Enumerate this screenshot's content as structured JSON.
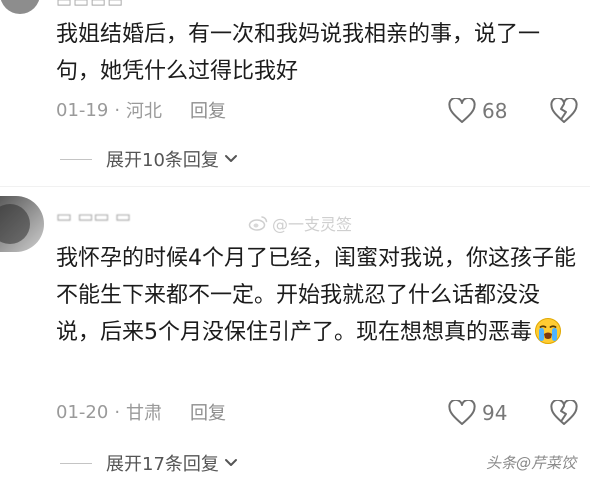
{
  "comments": [
    {
      "text": "我姐结婚后，有一次和我妈说我相亲的事，说了一句，她凭什么过得比我好",
      "date": "01-19",
      "separator": "·",
      "location": "河北",
      "reply_label": "回复",
      "likes": "68",
      "expand_label": "展开10条回复"
    },
    {
      "text": "我怀孕的时候4个月了已经，闺蜜对我说，你这孩子能不能生下来都不一定。开始我就忍了什么话都没没说，后来5个月没保住引产了。现在想想真的恶毒",
      "date": "01-20",
      "separator": "·",
      "location": "甘肃",
      "reply_label": "回复",
      "likes": "94",
      "expand_label": "展开17条回复"
    }
  ],
  "watermarks": {
    "top": "@一支灵签",
    "bottom": "头条@芹菜饺"
  },
  "colors": {
    "text": "#1c1c1c",
    "meta": "#9a9a9a",
    "icon_gray": "#777777"
  },
  "icons": {
    "like": "heart-outline-icon",
    "dislike": "broken-heart-icon",
    "expand": "chevron-down-icon",
    "emoji": "loudly-crying-face-icon",
    "watermark": "weibo-logo-icon"
  }
}
